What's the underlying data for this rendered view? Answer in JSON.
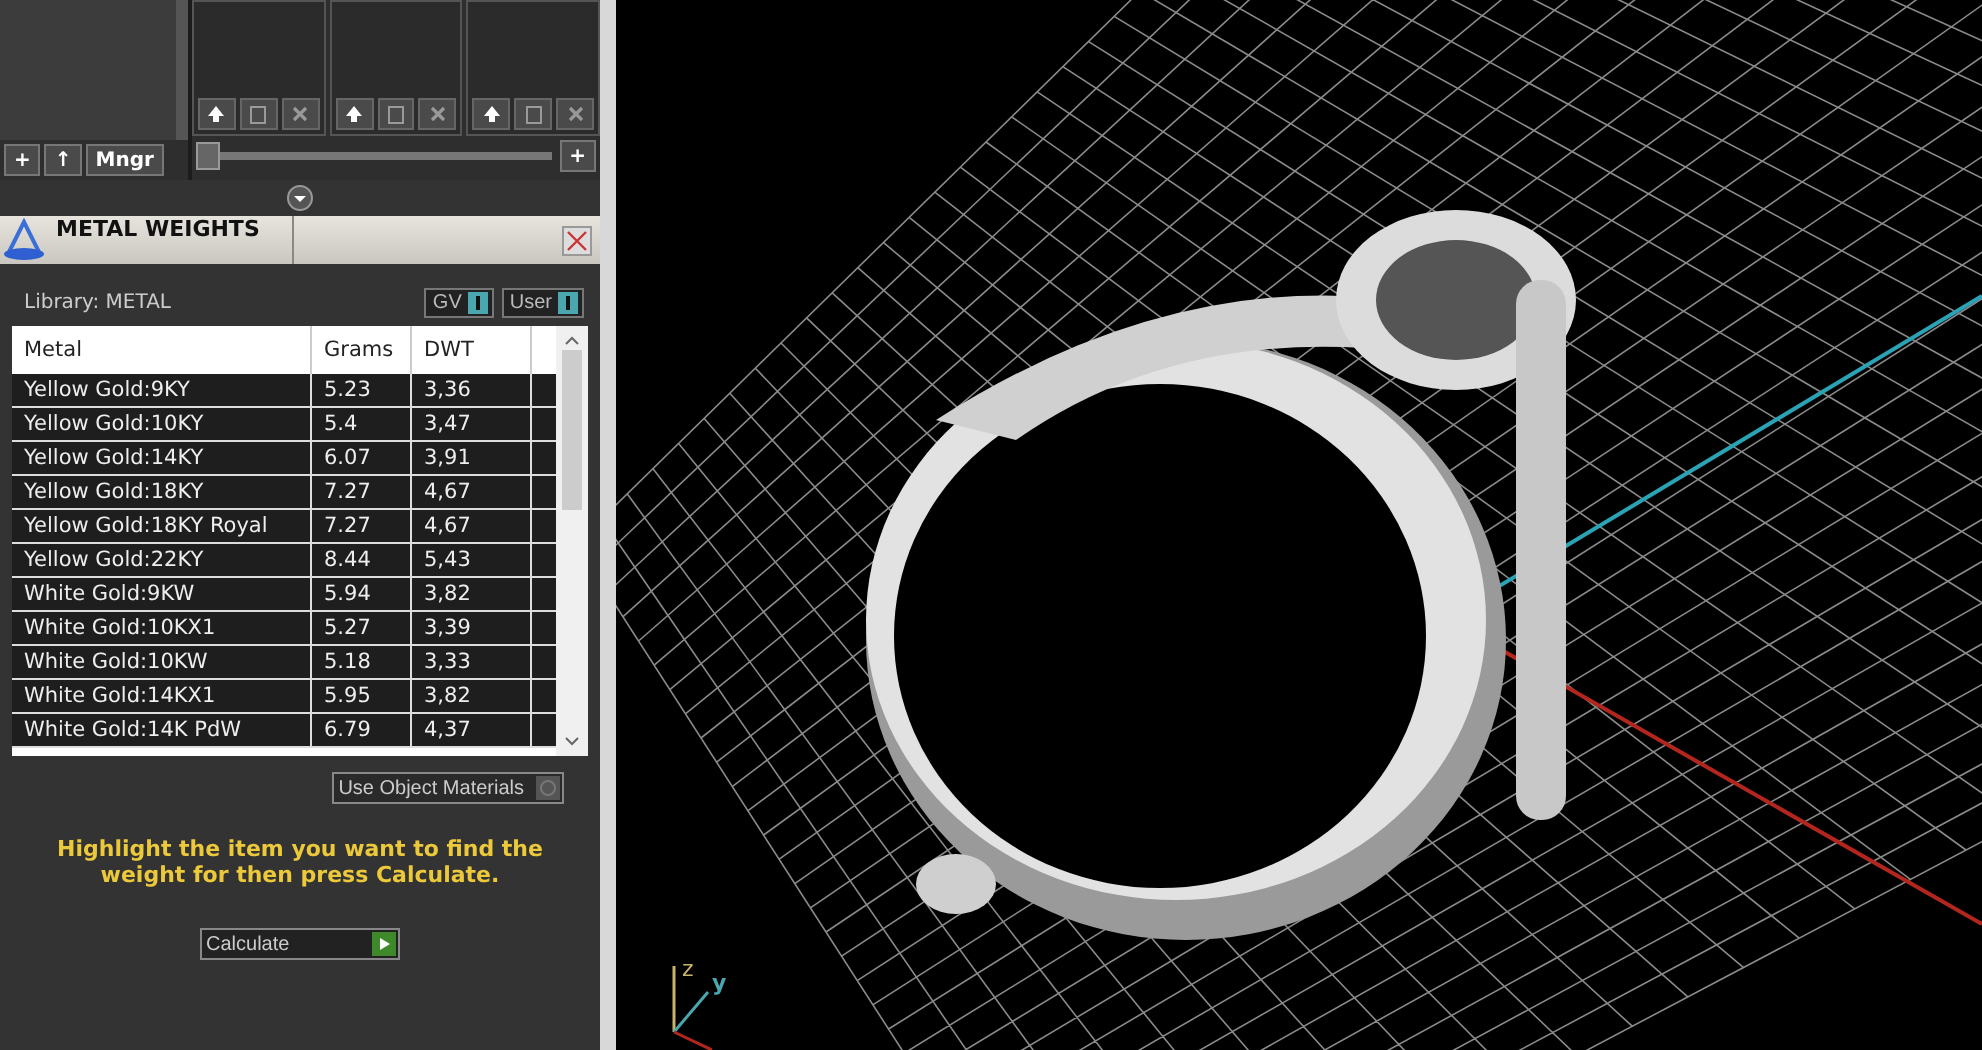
{
  "library_slots": {
    "main_buttons": [
      "+",
      "↑",
      "Mngr"
    ],
    "slider": {
      "level": 0
    },
    "add_button": "+"
  },
  "panel": {
    "title": "METAL WEIGHTS",
    "library_label": "Library: METAL",
    "toggles": [
      {
        "label": "GV",
        "on": true
      },
      {
        "label": "User",
        "on": true
      }
    ]
  },
  "table": {
    "columns": [
      "Metal",
      "Grams",
      "DWT"
    ],
    "rows": [
      {
        "metal": "Yellow Gold:9KY",
        "grams": "5.23",
        "dwt": "3,36"
      },
      {
        "metal": "Yellow Gold:10KY",
        "grams": "5.4",
        "dwt": "3,47"
      },
      {
        "metal": "Yellow Gold:14KY",
        "grams": "6.07",
        "dwt": "3,91"
      },
      {
        "metal": "Yellow Gold:18KY",
        "grams": "7.27",
        "dwt": "4,67"
      },
      {
        "metal": "Yellow Gold:18KY Royal",
        "grams": "7.27",
        "dwt": "4,67"
      },
      {
        "metal": "Yellow Gold:22KY",
        "grams": "8.44",
        "dwt": "5,43"
      },
      {
        "metal": "White Gold:9KW",
        "grams": "5.94",
        "dwt": "3,82"
      },
      {
        "metal": "White Gold:10KX1",
        "grams": "5.27",
        "dwt": "3,39"
      },
      {
        "metal": "White Gold:10KW",
        "grams": "5.18",
        "dwt": "3,33"
      },
      {
        "metal": "White Gold:14KX1",
        "grams": "5.95",
        "dwt": "3,82"
      },
      {
        "metal": "White Gold:14K PdW",
        "grams": "6.79",
        "dwt": "4,37"
      }
    ]
  },
  "use_object_materials": {
    "label": "Use Object Materials",
    "checked": false
  },
  "hint": "Highlight the item you want to find the weight for then press Calculate.",
  "calculate_button": "Calculate",
  "viewport": {
    "axis_labels": [
      "z",
      "y"
    ]
  }
}
